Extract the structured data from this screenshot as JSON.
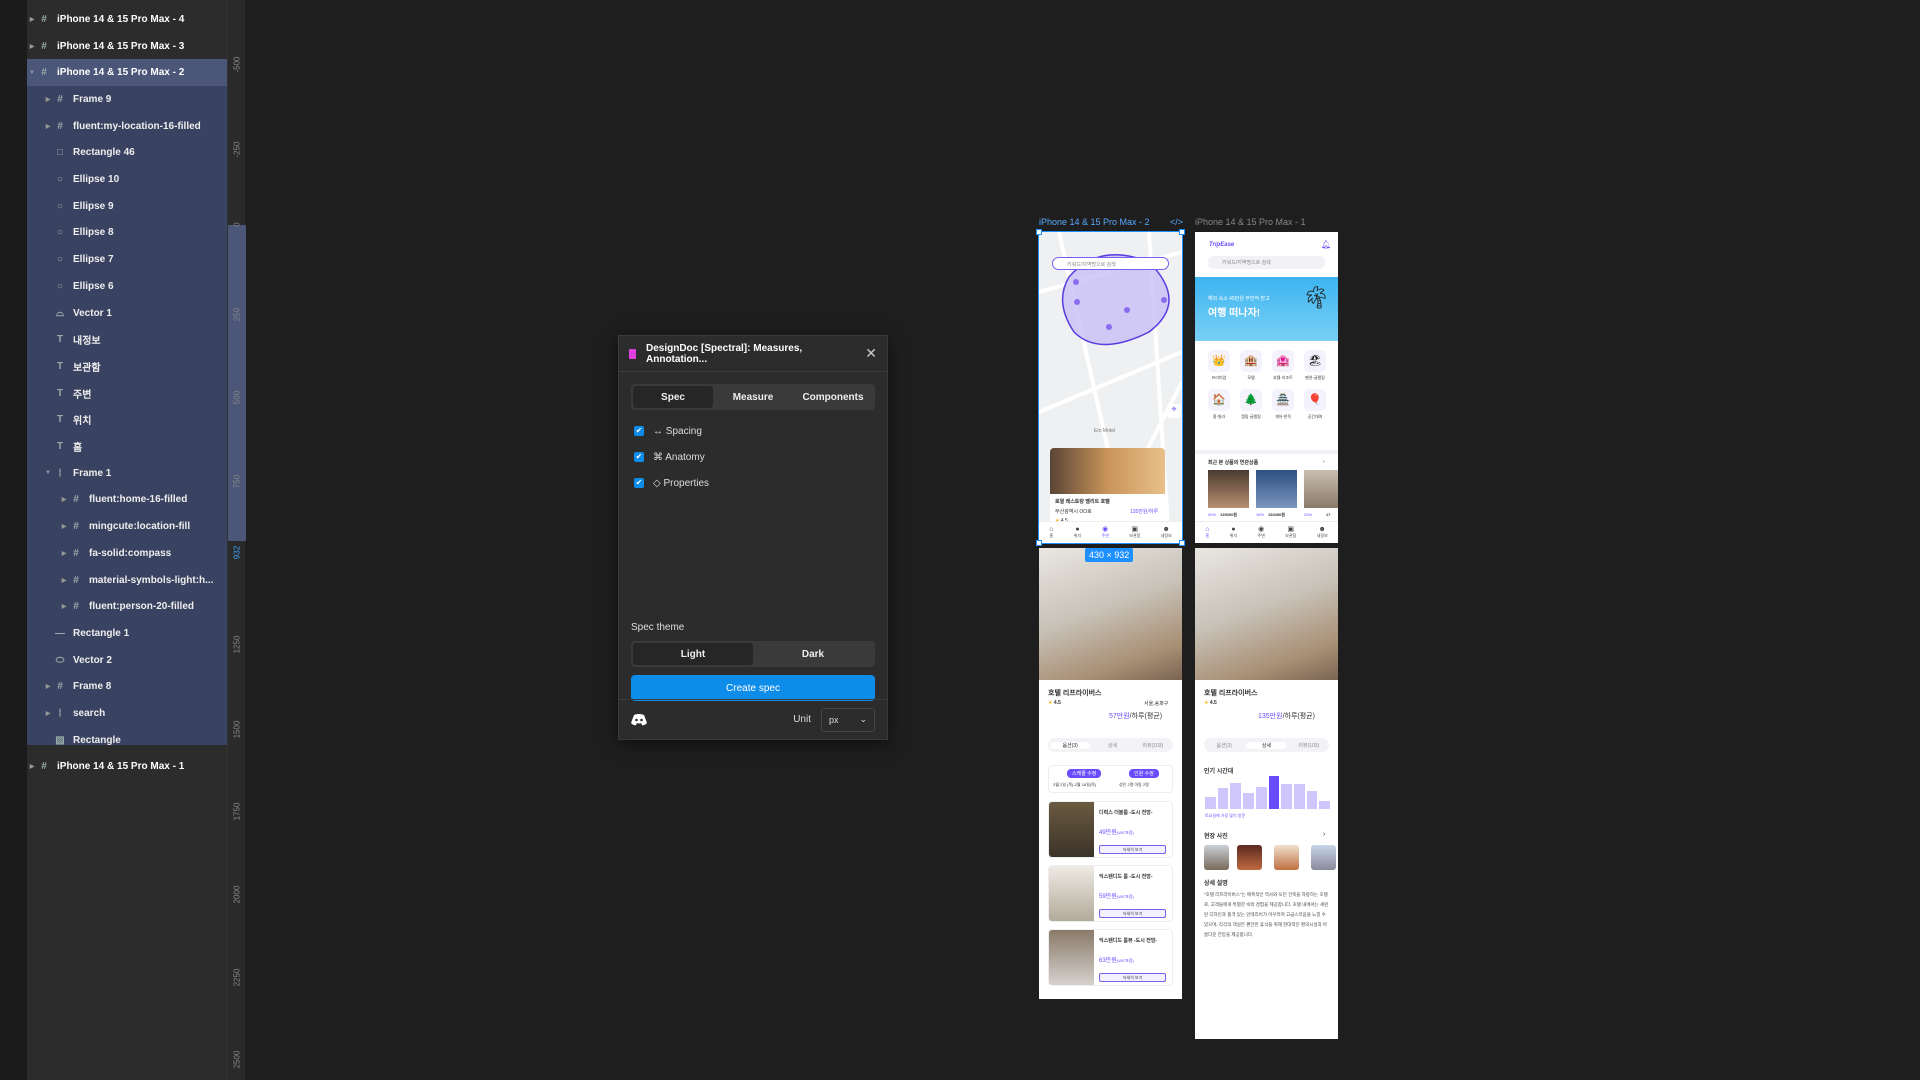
{
  "layers": [
    {
      "label": "iPhone 14 & 15 Pro Max - 4",
      "icon": "frame",
      "indent": 0,
      "arrow": "right",
      "top": true
    },
    {
      "label": "iPhone 14 & 15 Pro Max - 3",
      "icon": "frame",
      "indent": 0,
      "arrow": "right",
      "top": true
    },
    {
      "label": "iPhone 14 & 15 Pro Max - 2",
      "icon": "frame",
      "indent": 0,
      "arrow": "down",
      "top": true,
      "selected": true
    },
    {
      "label": "Frame 9",
      "icon": "frame",
      "indent": 1,
      "arrow": "right"
    },
    {
      "label": "fluent:my-location-16-filled",
      "icon": "frame",
      "indent": 1,
      "arrow": "right"
    },
    {
      "label": "Rectangle 46",
      "icon": "rectangle",
      "indent": 1
    },
    {
      "label": "Ellipse 10",
      "icon": "ellipse",
      "indent": 1
    },
    {
      "label": "Ellipse 9",
      "icon": "ellipse",
      "indent": 1
    },
    {
      "label": "Ellipse 8",
      "icon": "ellipse",
      "indent": 1
    },
    {
      "label": "Ellipse 7",
      "icon": "ellipse",
      "indent": 1
    },
    {
      "label": "Ellipse 6",
      "icon": "ellipse",
      "indent": 1
    },
    {
      "label": "Vector 1",
      "icon": "vector",
      "indent": 1
    },
    {
      "label": "내정보",
      "icon": "text",
      "indent": 1
    },
    {
      "label": "보관함",
      "icon": "text",
      "indent": 1
    },
    {
      "label": "주변",
      "icon": "text",
      "indent": 1
    },
    {
      "label": "위치",
      "icon": "text",
      "indent": 1
    },
    {
      "label": "홈",
      "icon": "text",
      "indent": 1
    },
    {
      "label": "Frame 1",
      "icon": "autolayout",
      "indent": 1,
      "arrow": "down"
    },
    {
      "label": "fluent:home-16-filled",
      "icon": "frame",
      "indent": 2,
      "arrow": "right"
    },
    {
      "label": "mingcute:location-fill",
      "icon": "frame",
      "indent": 2,
      "arrow": "right"
    },
    {
      "label": "fa-solid:compass",
      "icon": "frame",
      "indent": 2,
      "arrow": "right"
    },
    {
      "label": "material-symbols-light:h...",
      "icon": "frame",
      "indent": 2,
      "arrow": "right"
    },
    {
      "label": "fluent:person-20-filled",
      "icon": "frame",
      "indent": 2,
      "arrow": "right"
    },
    {
      "label": "Rectangle 1",
      "icon": "line",
      "indent": 1
    },
    {
      "label": "Vector 2",
      "icon": "vector2",
      "indent": 1
    },
    {
      "label": "Frame 8",
      "icon": "frame",
      "indent": 1,
      "arrow": "right"
    },
    {
      "label": "search",
      "icon": "autolayout",
      "indent": 1,
      "arrow": "right"
    },
    {
      "label": "Rectangle",
      "icon": "image",
      "indent": 1
    },
    {
      "label": "iPhone 14 & 15 Pro Max - 1",
      "icon": "frame",
      "indent": 0,
      "arrow": "right",
      "top": true
    }
  ],
  "ruler": {
    "ticks": [
      "-500",
      "-250",
      "0",
      "250",
      "500",
      "750",
      "932",
      "1250",
      "1500",
      "1750",
      "2000",
      "2250",
      "2500"
    ],
    "highlight": "932"
  },
  "plugin": {
    "title": "DesignDoc [Spectral]: Measures, Annotation...",
    "tabs": [
      "Spec",
      "Measure",
      "Components"
    ],
    "active_tab": "Spec",
    "options": [
      {
        "label": "↔ Spacing",
        "checked": true
      },
      {
        "label": "⌘ Anatomy",
        "checked": true
      },
      {
        "label": "◇ Properties",
        "checked": true
      }
    ],
    "theme_label": "Spec theme",
    "themes": [
      "Light",
      "Dark"
    ],
    "active_theme": "Light",
    "create_label": "Create spec",
    "unit_label": "Unit",
    "unit_value": "px",
    "accent": "#0d8ce9"
  },
  "canvas": {
    "frame2_label": "iPhone 14 & 15 Pro Max - 2",
    "frame2_code_icon": "</>",
    "frame1_label": "iPhone 14 & 15 Pro Max - 1",
    "size_badge": "430 × 932",
    "map": {
      "search_placeholder": "키워드/지역명으로 검색",
      "place_label": "Em Motel",
      "card_title": "로열 레스토랑 벨리트 호텔",
      "card_location": "부산광역시 OO로",
      "card_price": "135만원/하루",
      "card_rating": "4.5",
      "nav": [
        "홈",
        "위치",
        "주변",
        "보관함",
        "내정보"
      ]
    },
    "home": {
      "logo": "TripEase",
      "search_placeholder": "키워드/지역명으로 검색",
      "banner_sub": "해외 숙소 45만원 무한적 받고",
      "banner_title": "여행 떠나자!",
      "categories": [
        "프리미엄",
        "모텔",
        "호텔·리조트",
        "펜션·글램핑",
        "홈·빌라",
        "캠핑·글램핑",
        "게하·한옥",
        "공간대여"
      ],
      "recent_title": "최근 본 상품의 연관상품",
      "recent_prices": [
        "135000원",
        "153456원",
        "17"
      ],
      "recent_discounts": [
        "30%",
        "15%",
        "25%"
      ],
      "nav": [
        "홈",
        "위치",
        "주변",
        "보관함",
        "내정보"
      ]
    },
    "detail": {
      "hotel_name": "호텔 리프라이버스",
      "rating": "4.5",
      "location": "서울,송파구",
      "price_a": "57만원",
      "price_b": "135만원",
      "price_suffix": "/하루(평균)",
      "tabs": [
        "옵션(3)",
        "상세",
        "리뷰(103)"
      ],
      "schedule_btn": "스케줄 수정",
      "people_btn": "인원 수정",
      "schedule_text": "2월 2일 (목)-2월 16일(목)",
      "people_text": "성인 2명 아동 2명",
      "rooms": [
        {
          "name": "디럭스 더블룸 -도시 전망-",
          "price": "49만원",
          "vat": "(VAT포함)",
          "btn": "자세히 보기"
        },
        {
          "name": "익스텐디드 룸 -도시 전망-",
          "price": "59만원",
          "vat": "(VAT포함)",
          "btn": "자세히 보기"
        },
        {
          "name": "익스텐디드 룸뷰 -도시 전망-",
          "price": "63만원",
          "vat": "(VAT포함)",
          "btn": "자세히 보기"
        }
      ],
      "popular_title": "인기 시간대",
      "popular_bars": [
        35,
        65,
        80,
        48,
        68,
        100,
        75,
        75,
        55,
        25
      ],
      "popular_note": "토요일에 가장 많이 방문",
      "photos_title": "현장 사진",
      "desc_title": "상세 설명",
      "desc": "\"호텔 리프라이버스\"는 매혹적인 역사와 모던 건축을 자랑하는 호텔로, 고객들에게 특별한 숙박 경험을 제공합니다. 호텔 내에서는 세련된 디자인과 품격 있는 인테리어가 어우러져 고급스러움을 느낄 수 있으며, 각각의 객실은 편안한 휴식을 위해 현대적인 편의시설과 아름다운 전망을 제공합니다."
    }
  }
}
